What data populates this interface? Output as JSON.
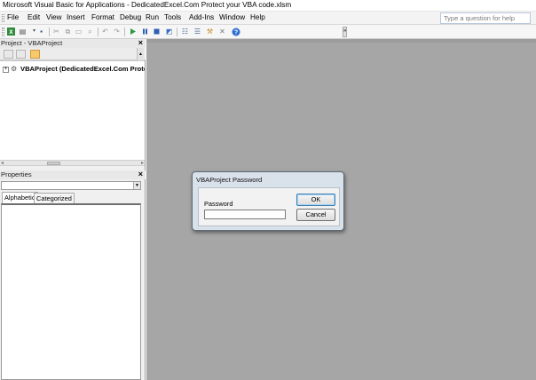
{
  "window": {
    "title": "Microsoft Visual Basic for Applications - DedicatedExcel.Com Protect your VBA code.xlsm"
  },
  "menubar": {
    "items": [
      {
        "label": "File",
        "name": "menu-file"
      },
      {
        "label": "Edit",
        "name": "menu-edit"
      },
      {
        "label": "View",
        "name": "menu-view"
      },
      {
        "label": "Insert",
        "name": "menu-insert"
      },
      {
        "label": "Format",
        "name": "menu-format"
      },
      {
        "label": "Debug",
        "name": "menu-debug"
      },
      {
        "label": "Run",
        "name": "menu-run"
      },
      {
        "label": "Tools",
        "name": "menu-tools"
      },
      {
        "label": "Add-Ins",
        "name": "menu-add-ins"
      },
      {
        "label": "Window",
        "name": "menu-window"
      },
      {
        "label": "Help",
        "name": "menu-help"
      }
    ],
    "help_placeholder": "Type a question for help"
  },
  "toolbar": {
    "icons": [
      "view-excel-icon",
      "insert-module-icon",
      "save-icon",
      "cut-icon",
      "copy-icon",
      "paste-icon",
      "find-icon",
      "undo-icon",
      "redo-icon",
      "run-icon",
      "break-icon",
      "reset-icon",
      "design-mode-icon",
      "project-explorer-icon",
      "properties-window-icon",
      "object-browser-icon",
      "toolbox-icon",
      "help-icon"
    ],
    "colors": {
      "run": "#2e9a3e",
      "break": "#2f5fb3",
      "reset": "#2f5fb3",
      "help": "#2f6fd0"
    }
  },
  "project_pane": {
    "title": "Project - VBAProject",
    "close_label": "×",
    "tree": [
      {
        "expander": "+",
        "label": "VBAProject (DedicatedExcel.Com Protect your VBA code.xlsm)"
      }
    ]
  },
  "properties_pane": {
    "title": "Properties",
    "close_label": "×",
    "tabs": [
      {
        "label": "Alphabetic",
        "active": true
      },
      {
        "label": "Categorized",
        "active": false
      }
    ]
  },
  "dialog": {
    "title": "VBAProject Password",
    "password_label": "Password",
    "password_value": "",
    "ok_label": "OK",
    "cancel_label": "Cancel"
  },
  "colors": {
    "workspace": "#a6a6a6",
    "dialog_frame": "#d9e1ea"
  }
}
